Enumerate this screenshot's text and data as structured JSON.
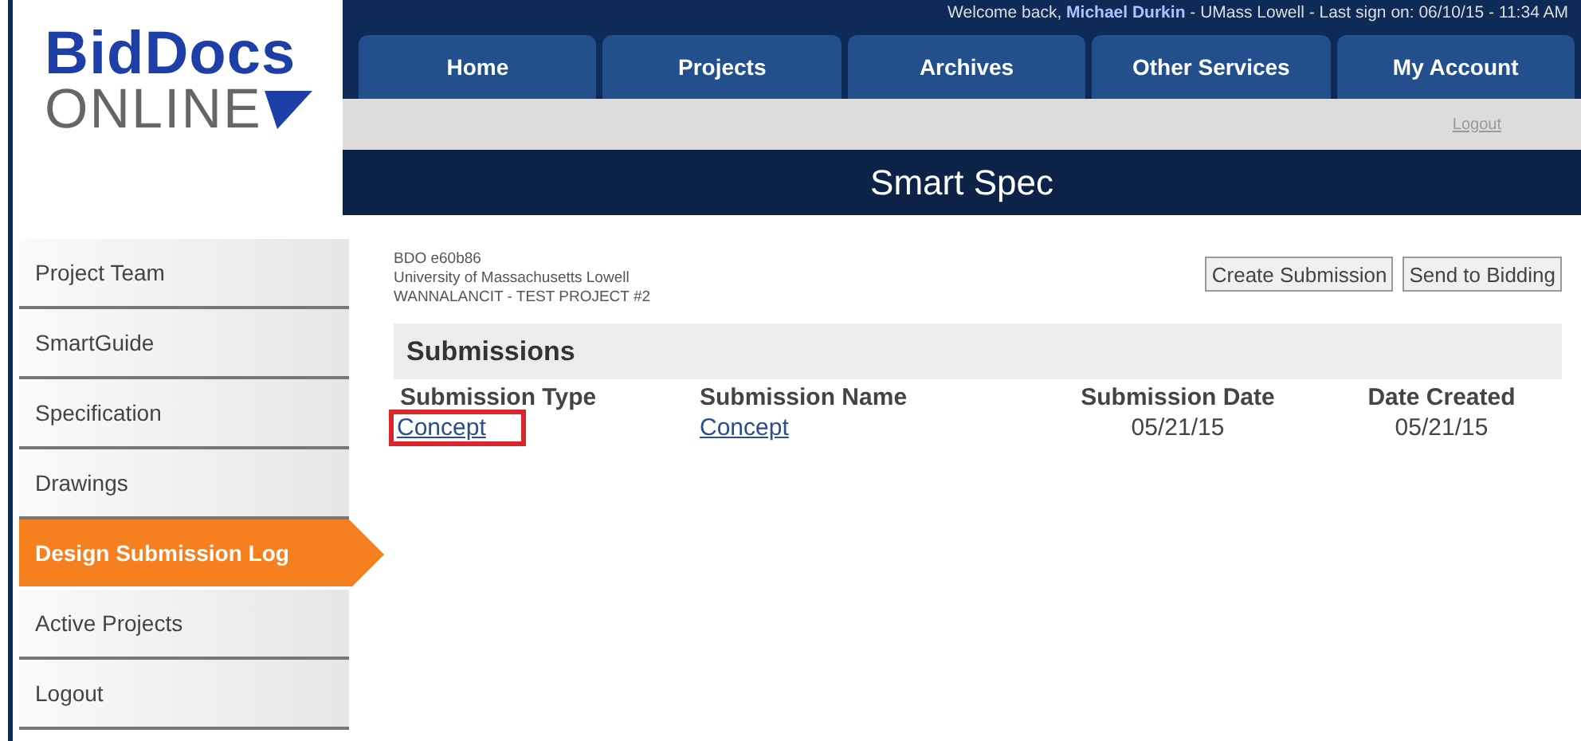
{
  "logo": {
    "line1": "BidDocs",
    "line2": "ONLINE"
  },
  "welcome": "Welcome back, **Michael Durkin** - UMass Lowell - Last sign on: 06/10/15 - 11:34 AM",
  "tabs": [
    {
      "label": "Home",
      "selected": false
    },
    {
      "label": "Projects",
      "selected": false
    },
    {
      "label": "Archives",
      "selected": false
    },
    {
      "label": "Other Services",
      "selected": false
    },
    {
      "label": "My Account",
      "selected": false
    }
  ],
  "top_logout": "Logout",
  "page_title": "Smart Spec",
  "sidebar": {
    "items": [
      {
        "label": "Project Team",
        "selected": false
      },
      {
        "label": "SmartGuide",
        "selected": false
      },
      {
        "label": "Specification",
        "selected": false
      },
      {
        "label": "Drawings",
        "selected": false
      },
      {
        "label": "Design Submission Log",
        "selected": true
      },
      {
        "label": "Active Projects",
        "selected": false
      },
      {
        "label": "Logout",
        "selected": false
      }
    ]
  },
  "project": {
    "lines": [
      "BDO e60b86",
      "University of Massachusetts Lowell",
      "WANNALANCIT - TEST PROJECT #2"
    ]
  },
  "buttons": [
    "Create Submission",
    "Send to Bidding"
  ],
  "submissions": {
    "title": "Submissions",
    "columns": [
      "Submission Type",
      "Submission Name",
      "Submission Date",
      "Date Created"
    ],
    "rows": [
      {
        "type": "Concept",
        "name": "Concept",
        "submission_date": "05/21/15",
        "date_created": "05/21/15",
        "highlighted": true
      }
    ]
  }
}
